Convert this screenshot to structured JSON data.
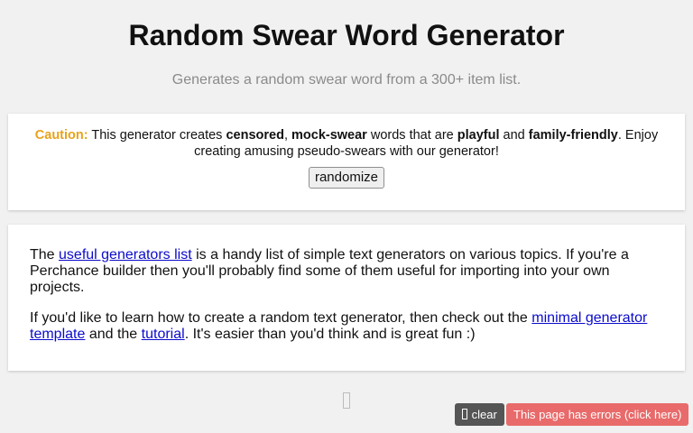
{
  "header": {
    "title": "Random Swear Word Generator",
    "subtitle": "Generates a random swear word from a 300+ item list."
  },
  "output": {
    "caution_label": "Caution:",
    "text_1": " This generator creates ",
    "bold_censored": "censored",
    "text_2": ", ",
    "bold_mock_swear": "mock-swear",
    "text_3": " words that are ",
    "bold_playful": "playful",
    "text_4": " and ",
    "bold_family_friendly": "family-friendly",
    "text_5": ". Enjoy creating amusing pseudo-swears with our generator!",
    "randomize_label": "randomize",
    "caution_color": "#e8a21a"
  },
  "info": {
    "p1_text_1": "The ",
    "p1_link": "useful generators list",
    "p1_text_2": " is a handy list of simple text generators on various topics. If you're a Perchance builder then you'll probably find some of them useful for importing into your own projects.",
    "p2_text_1": "If you'd like to learn how to create a random text generator, then check out the ",
    "p2_link_1": "minimal generator template",
    "p2_text_2": " and the ",
    "p2_link_2": "tutorial",
    "p2_text_3": ". It's easier than you'd think and is great fun :)",
    "link_color": "#0b0bcc"
  },
  "footer": {
    "clear_label": "clear",
    "error_label": "This page has errors (click here)",
    "error_color": "#e86a6a"
  }
}
